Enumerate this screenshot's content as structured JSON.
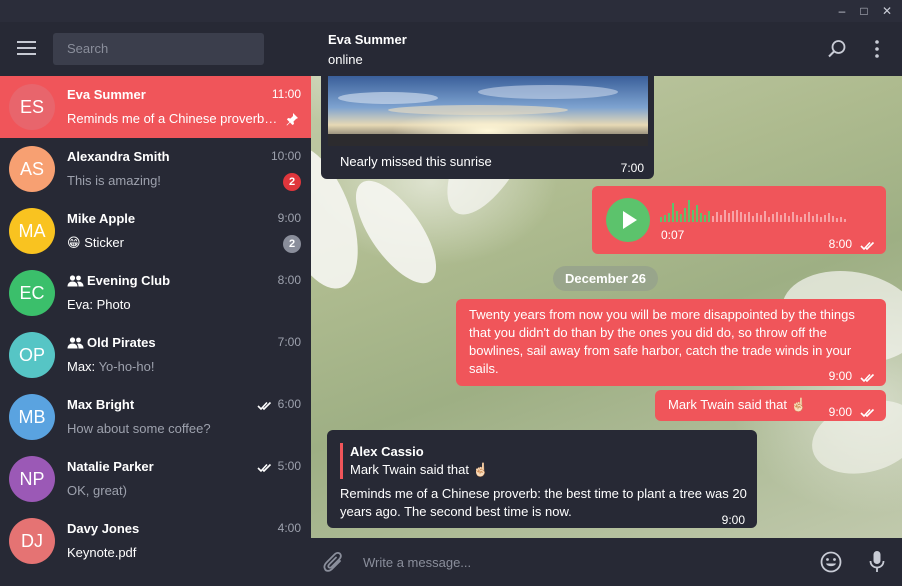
{
  "window": {
    "minimize": "–",
    "maximize": "□",
    "close": "✕"
  },
  "search": {
    "placeholder": "Search"
  },
  "chats": [
    {
      "initials": "ES",
      "name": "Eva Summer",
      "time": "11:00",
      "preview": "Reminds me of a Chinese proverb: the best time to plant a tree...",
      "avatar_color": "#e8656c",
      "pinned": true
    },
    {
      "initials": "AS",
      "name": "Alexandra Smith",
      "time": "10:00",
      "preview": "This is amazing!",
      "avatar_color": "#f7a072",
      "badge": "2",
      "badge_color": "#e0363c"
    },
    {
      "initials": "MA",
      "name": "Mike Apple",
      "time": "9:00",
      "preview_icon": "😁",
      "preview": "Sticker",
      "avatar_color": "#f9c320",
      "badge": "2",
      "badge_color": "#8a8e9b"
    },
    {
      "initials": "EC",
      "name": "Evening Club",
      "time": "8:00",
      "preview_sender": "Eva:",
      "preview": "Photo",
      "avatar_color": "#3bbf6b",
      "group": true
    },
    {
      "initials": "OP",
      "name": "Old Pirates",
      "time": "7:00",
      "preview_sender": "Max:",
      "preview": "Yo-ho-ho!",
      "avatar_color": "#56c5c5",
      "group": true
    },
    {
      "initials": "MB",
      "name": "Max Bright",
      "time": "6:00",
      "preview": "How about some coffee?",
      "avatar_color": "#5aa3e0",
      "read": true
    },
    {
      "initials": "NP",
      "name": "Natalie Parker",
      "time": "5:00",
      "preview": "OK, great)",
      "avatar_color": "#9b59b6",
      "read": true
    },
    {
      "initials": "DJ",
      "name": "Davy Jones",
      "time": "4:00",
      "preview": "Keynote.pdf",
      "avatar_color": "#e57373"
    }
  ],
  "header": {
    "name": "Eva Summer",
    "status": "online"
  },
  "messages": {
    "photo": {
      "caption": "Nearly missed this sunrise",
      "time": "7:00"
    },
    "voice": {
      "duration": "0:07",
      "time": "8:00"
    },
    "date": "December 26",
    "quote": {
      "text": "Twenty years from now you will be more disappointed by the things that you didn't do than by the ones you did do, so throw off the bowlines, sail away from safe harbor, catch the trade winds in your sails.",
      "time": "9:00"
    },
    "twain": {
      "text": "Mark Twain said that ☝🏻",
      "time": "9:00"
    },
    "reply": {
      "author": "Alex Cassio",
      "quoted": "Mark Twain said that ☝🏻",
      "text": "Reminds me of a Chinese proverb: the best time to plant a tree was 20 years ago. The second best time is now.",
      "time": "9:00"
    }
  },
  "composer": {
    "placeholder": "Write a message..."
  },
  "colors": {
    "accent": "#f0555a",
    "panel": "#272935",
    "voice_play": "#5cc36c"
  }
}
